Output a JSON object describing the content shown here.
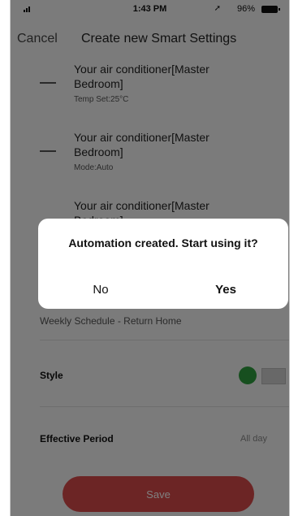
{
  "status_bar": {
    "time": "1:43 PM",
    "battery": "96%"
  },
  "nav": {
    "cancel": "Cancel",
    "title": "Create new Smart Settings"
  },
  "actions": [
    {
      "name": "Your air conditioner[Master Bedroom]",
      "detail": "Temp Set:25°C"
    },
    {
      "name": "Your air conditioner[Master Bedroom]",
      "detail": "Mode:Auto"
    },
    {
      "name": "Your air conditioner[Master Bedroom]",
      "detail": ""
    }
  ],
  "schedule_label": "Weekly Schedule - Return Home",
  "style": {
    "label": "Style",
    "color": "#2e9e3f"
  },
  "effective_period": {
    "label": "Effective Period",
    "value": "All day"
  },
  "save_label": "Save",
  "dialog": {
    "message": "Automation created. Start using it?",
    "no_label": "No",
    "yes_label": "Yes"
  },
  "colors": {
    "accent": "#d84a4a",
    "style_green": "#2e9e3f"
  }
}
